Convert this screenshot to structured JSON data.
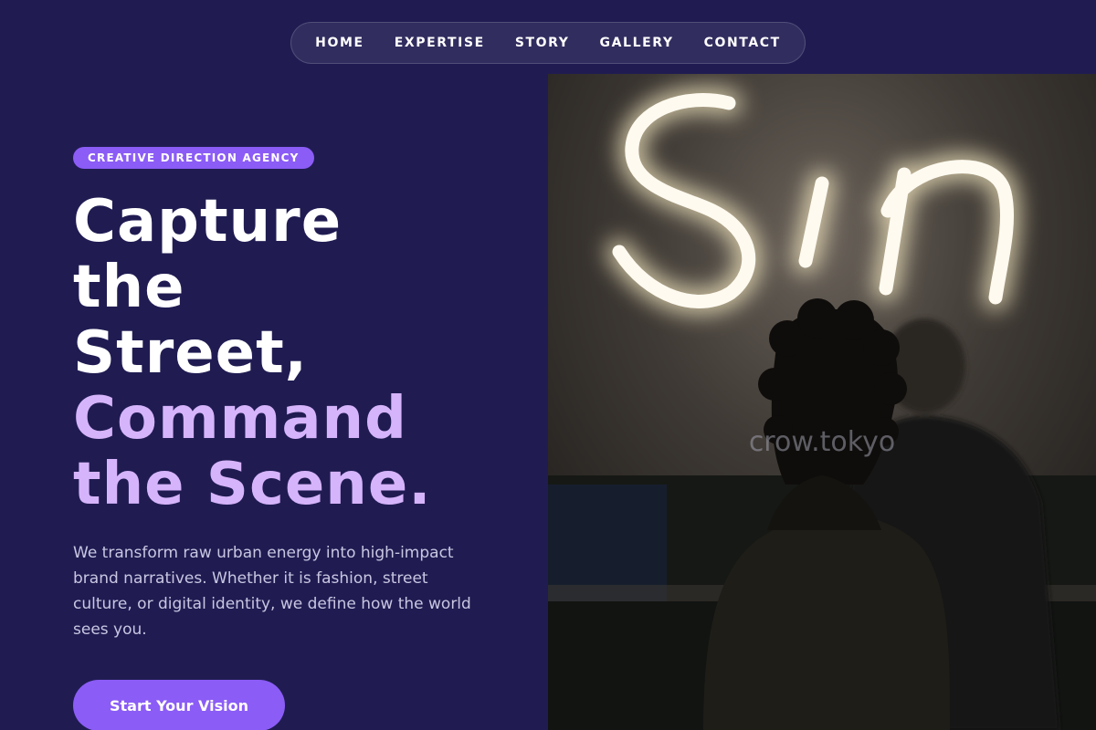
{
  "nav": {
    "items": [
      {
        "label": "HOME"
      },
      {
        "label": "EXPERTISE"
      },
      {
        "label": "STORY"
      },
      {
        "label": "GALLERY"
      },
      {
        "label": "CONTACT"
      }
    ]
  },
  "hero": {
    "badge": "CREATIVE DIRECTION AGENCY",
    "headline_lines": [
      {
        "text": "Capture",
        "style": "white"
      },
      {
        "text": "the",
        "style": "white"
      },
      {
        "text": "Street,",
        "style": "white"
      },
      {
        "text": "Command",
        "style": "accent"
      },
      {
        "text": "the Scene.",
        "style": "accent"
      }
    ],
    "description": "We transform raw urban energy into high-impact brand narratives. Whether it is fashion, street culture, or digital identity, we define how the world sees you.",
    "cta_label": "Start Your Vision"
  },
  "photo": {
    "neon_text": "Sin",
    "watermark": "crow.tokyo"
  },
  "colors": {
    "background": "#201c52",
    "accent": "#8b5cf6",
    "headline_accent": "#d6b4fb",
    "body_text": "#c9c6e2"
  }
}
